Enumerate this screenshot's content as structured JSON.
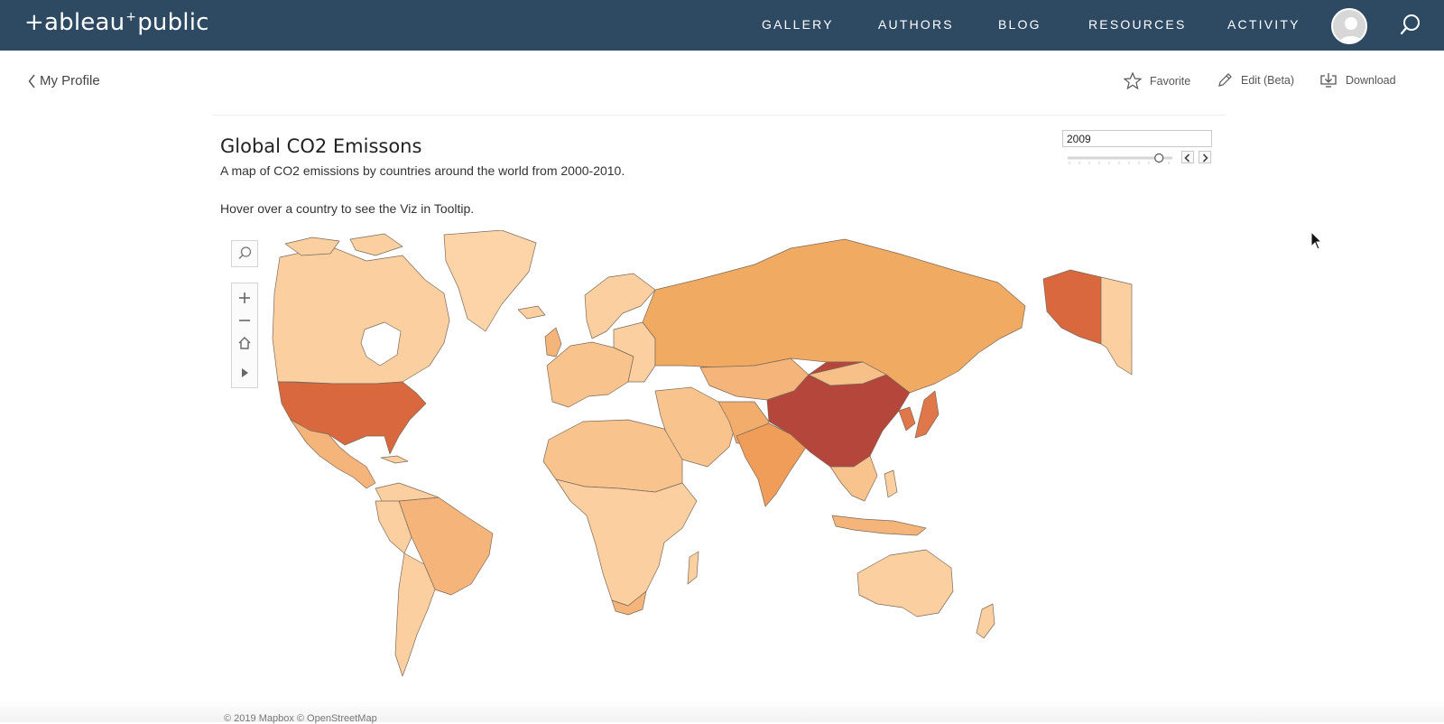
{
  "nav": {
    "logo": {
      "pre": "+ableau",
      "spark": "+",
      "post": "public"
    },
    "items": [
      "GALLERY",
      "AUTHORS",
      "BLOG",
      "RESOURCES",
      "ACTIVITY"
    ]
  },
  "subheader": {
    "back_label": "My Profile",
    "actions": {
      "favorite": "Favorite",
      "edit": "Edit (Beta)",
      "download": "Download"
    }
  },
  "viz": {
    "title": "Global CO2 Emissons",
    "subtitle": "A map of CO2 emissions by countries around the world from 2000-2010.",
    "hint": "Hover over a country to see the Viz in Tooltip.",
    "year_filter": {
      "value": "2009",
      "position_fraction": 0.9
    }
  },
  "map": {
    "attribution": "© 2019 Mapbox  © OpenStreetMap",
    "colors": {
      "low": "#fbcf9f",
      "mid": "#f0aa62",
      "high": "#d9683f",
      "highest": "#b4463b",
      "ocean": "#ffffff",
      "border": "#7a6a5a"
    }
  },
  "colors": {
    "topbar": "#2e4a62",
    "accent": "#ffffff"
  }
}
